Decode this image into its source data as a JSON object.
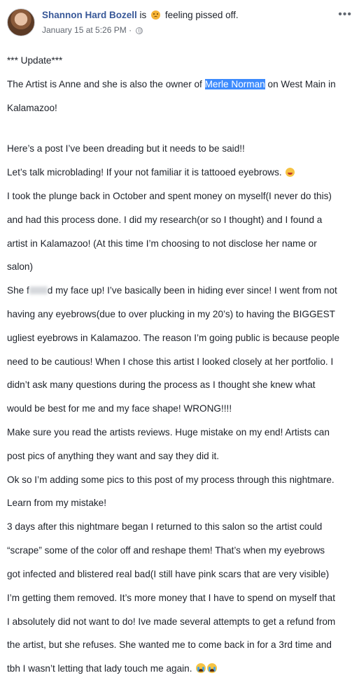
{
  "header": {
    "name": "Shannon Hard Bozell",
    "is_text": "is",
    "feeling": "feeling pissed off.",
    "date": "January 15 at 5:26 PM",
    "separator": "·"
  },
  "post": {
    "lines": [
      "*** Update***",
      "The Artist is Anne and she is also the owner of ",
      "Merle Norman",
      " on West Main in",
      "Kalamazoo!",
      "Here’s a post I’ve been dreading but it needs to be said!!",
      "Let’s talk microblading! If your not familiar it is tattooed eyebrows.",
      "I took the plunge back in October and spent money on myself(I never do this)",
      "and had this process done. I did my research(or so I thought) and I found a",
      "artist in Kalamazoo! (At this time I’m choosing to not disclose her name or",
      "salon)",
      "She f",
      "d my face up! I’ve basically been in hiding ever since! I went from not",
      "having any eyebrows(due to over plucking in my 20’s) to having the BIGGEST",
      "ugliest eyebrows in Kalamazoo. The reason I’m going public is because people",
      "need to be cautious! When I chose this artist I looked closely at her portfolio. I",
      "didn’t ask many questions during the process as I thought she knew what",
      "would be best for me and my face shape! WRONG!!!!",
      "Make sure you read the artists reviews. Huge mistake on my end! Artists can",
      "post pics of anything they want and say they did it.",
      "Ok so I’m adding some pics to this post of my process through this nightmare.",
      "Learn from my mistake!",
      "3 days after this nightmare began I returned to this salon so the artist could",
      "“scrape” some of the color off and reshape them! That’s when my eyebrows",
      "got infected and blistered real bad(I still have pink scars that are very visible)",
      "I’m getting them removed. It’s more money that I have to spend on myself that",
      "I absolutely did not want to do! Ive made several attempts to get a refund from",
      "the artist, but she refuses. She wanted me to come back in for a 3rd time and",
      "tbh I wasn’t letting that lady touch me again."
    ]
  },
  "icons": [
    "avatar",
    "feeling-emoji-icon",
    "globe-icon",
    "more-options-icon",
    "grimace-emoji-icon",
    "crying-emoji-icon"
  ],
  "colors": {
    "name": "#385898",
    "highlight": "#3d8bfd",
    "meta": "#616770"
  }
}
